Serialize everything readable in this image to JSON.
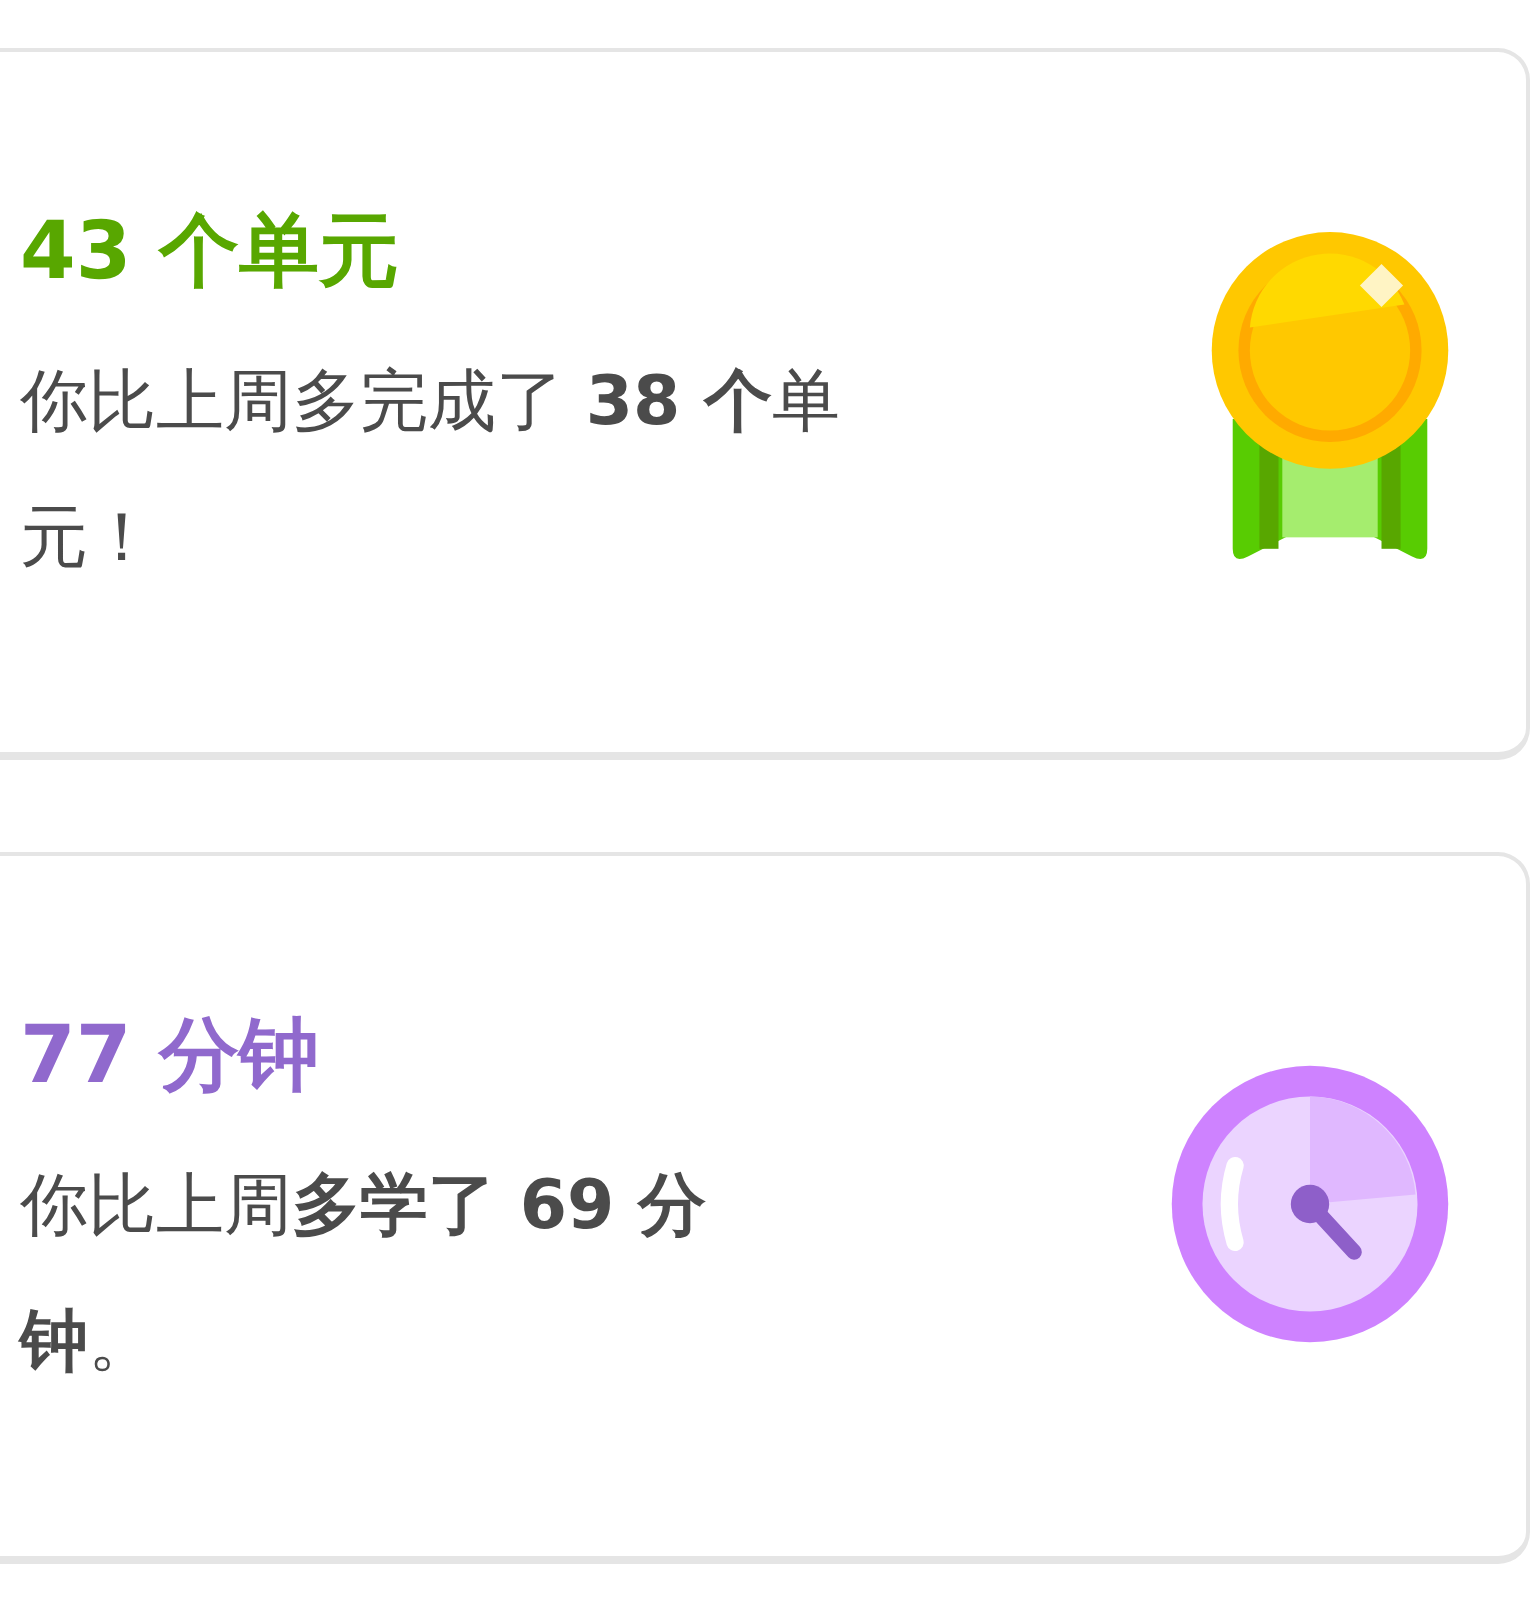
{
  "cards": [
    {
      "kind": "medal",
      "title": "43 个单元",
      "color": "#58a700",
      "text": "你比上周多完成了 **38 个**单元！"
    },
    {
      "kind": "clock",
      "title": "77 分钟",
      "color": "#9069cd",
      "text": "你比上周**多学了 69 分钟**。"
    }
  ]
}
